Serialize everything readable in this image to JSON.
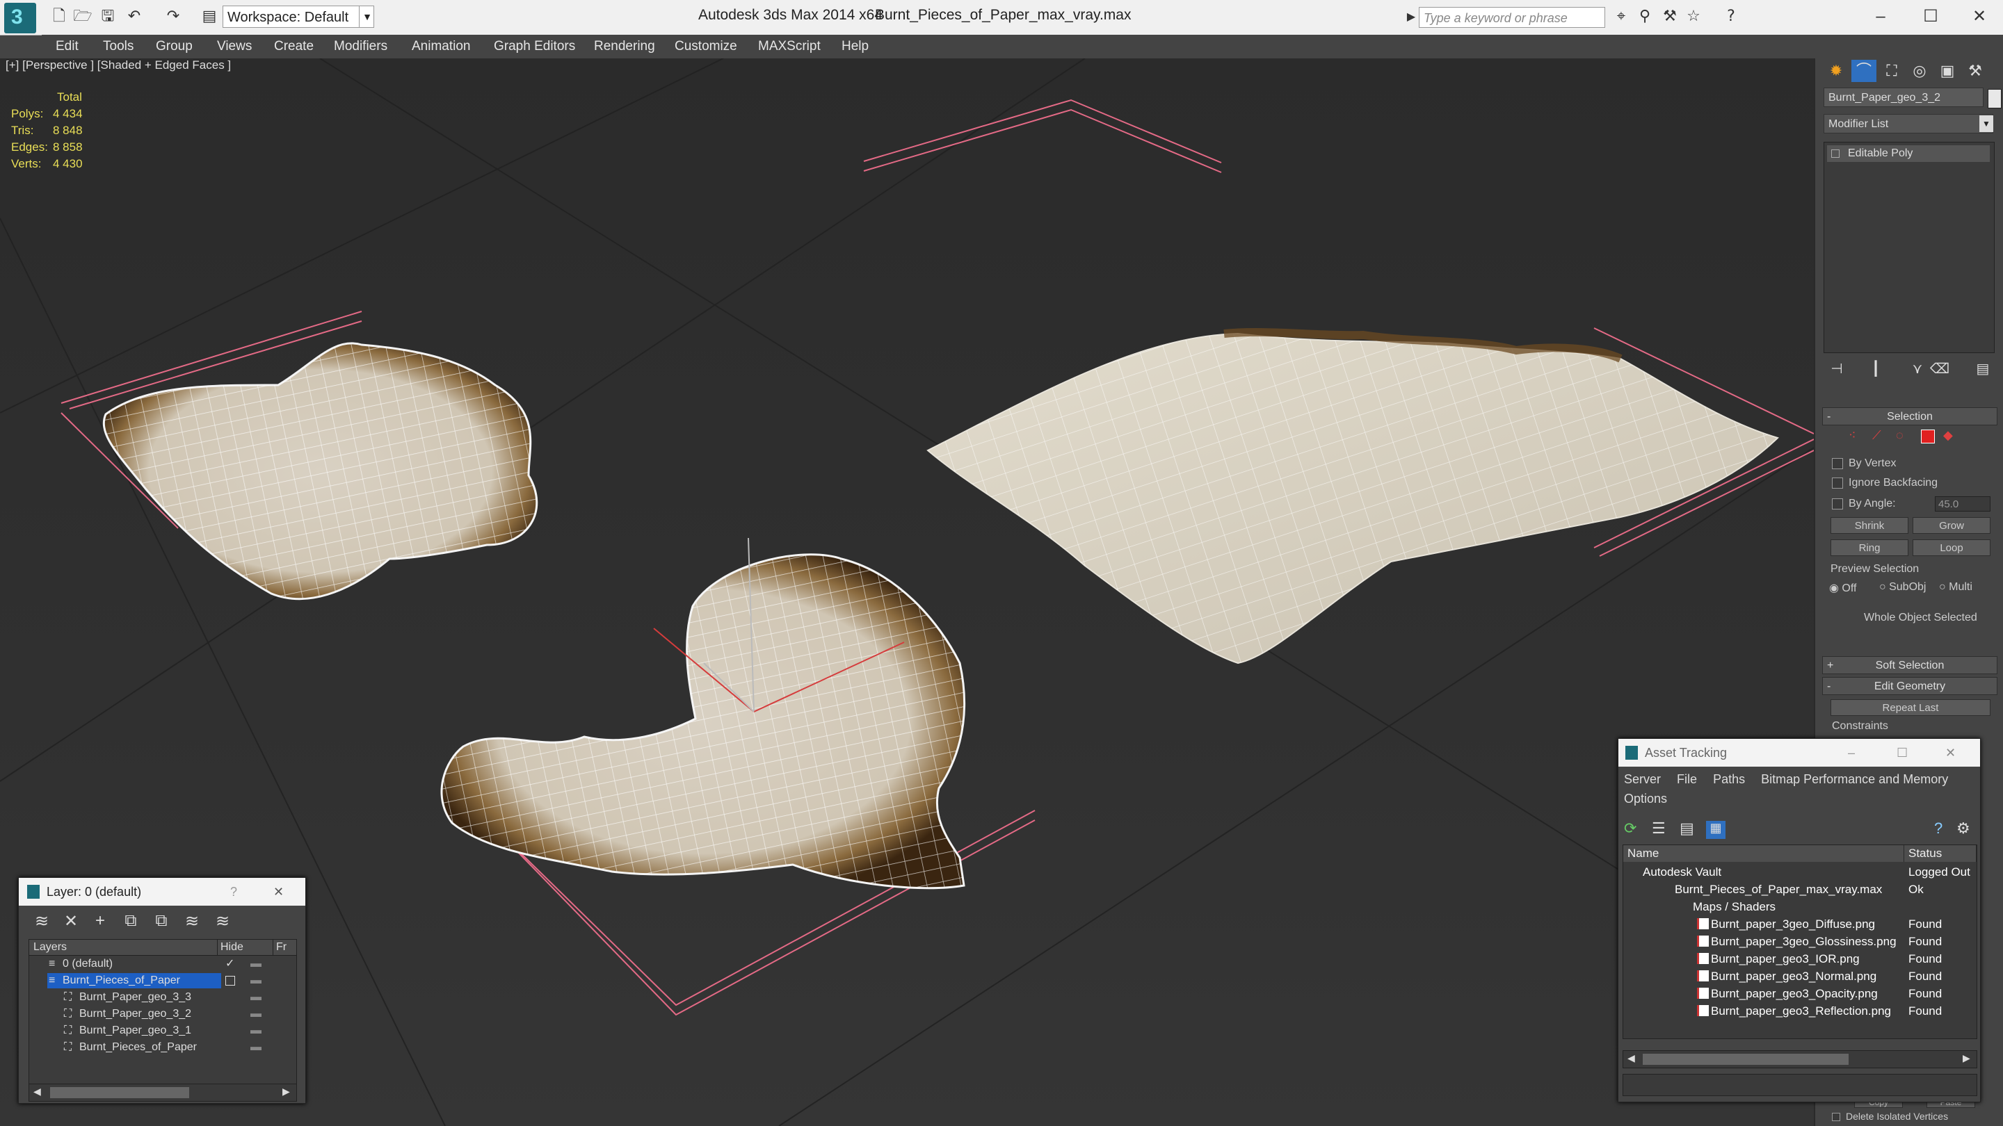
{
  "app": {
    "title": "Autodesk 3ds Max  2014 x64",
    "file": "Burnt_Pieces_of_Paper_max_vray.max",
    "workspace": "Workspace: Default",
    "search_placeholder": "Type a keyword or phrase"
  },
  "menu": [
    "Edit",
    "Tools",
    "Group",
    "Views",
    "Create",
    "Modifiers",
    "Animation",
    "Graph Editors",
    "Rendering",
    "Customize",
    "MAXScript",
    "Help"
  ],
  "viewport": {
    "label": "[+] [Perspective ] [Shaded + Edged Faces ]",
    "stats": {
      "total": "Total",
      "polys_label": "Polys:",
      "polys": "4 434",
      "tris_label": "Tris:",
      "tris": "8 848",
      "edges_label": "Edges:",
      "edges": "8 858",
      "verts_label": "Verts:",
      "verts": "4 430"
    }
  },
  "command_panel": {
    "object_name": "Burnt_Paper_geo_3_2",
    "modifier_list": "Modifier List",
    "stack_item": "Editable Poly",
    "selection_header": "Selection",
    "by_vertex": "By Vertex",
    "ignore_backfacing": "Ignore Backfacing",
    "by_angle": "By Angle:",
    "angle_value": "45.0",
    "shrink": "Shrink",
    "grow": "Grow",
    "ring": "Ring",
    "loop": "Loop",
    "preview_selection": "Preview Selection",
    "off": "Off",
    "subobj": "SubObj",
    "multi": "Multi",
    "whole_object": "Whole Object Selected",
    "soft_selection": "Soft Selection",
    "edit_geometry": "Edit Geometry",
    "repeat_last": "Repeat Last",
    "constraints": "Constraints",
    "copy": "Copy",
    "paste": "Paste",
    "delete_isolated": "Delete Isolated Vertices",
    "plus": "+",
    "minus": "-",
    "accent": "#e02020"
  },
  "layer_window": {
    "title": "Layer: 0 (default)",
    "help": "?",
    "col_layers": "Layers",
    "col_hide": "Hide",
    "col_fr": "Fr",
    "rows": [
      {
        "name": "0 (default)",
        "indent": 0
      },
      {
        "name": "Burnt_Pieces_of_Paper",
        "indent": 0
      },
      {
        "name": "Burnt_Paper_geo_3_3",
        "indent": 1
      },
      {
        "name": "Burnt_Paper_geo_3_2",
        "indent": 1
      },
      {
        "name": "Burnt_Paper_geo_3_1",
        "indent": 1
      },
      {
        "name": "Burnt_Pieces_of_Paper",
        "indent": 1
      }
    ],
    "selected_color": "#1d5fc4"
  },
  "asset_window": {
    "title": "Asset Tracking",
    "menu": [
      "Server",
      "File",
      "Paths",
      "Bitmap Performance and Memory"
    ],
    "menu2": "Options",
    "col_name": "Name",
    "col_status": "Status",
    "rows": [
      {
        "name": "Autodesk Vault",
        "status": "Logged Out",
        "indent": 0
      },
      {
        "name": "Burnt_Pieces_of_Paper_max_vray.max",
        "status": "Ok",
        "indent": 1
      },
      {
        "name": "Maps / Shaders",
        "status": "",
        "indent": 2
      },
      {
        "name": "Burnt_paper_3geo_Diffuse.png",
        "status": "Found",
        "indent": 3
      },
      {
        "name": "Burnt_paper_3geo_Glossiness.png",
        "status": "Found",
        "indent": 3
      },
      {
        "name": "Burnt_paper_geo3_IOR.png",
        "status": "Found",
        "indent": 3
      },
      {
        "name": "Burnt_paper_geo3_Normal.png",
        "status": "Found",
        "indent": 3
      },
      {
        "name": "Burnt_paper_geo3_Opacity.png",
        "status": "Found",
        "indent": 3
      },
      {
        "name": "Burnt_paper_geo3_Reflection.png",
        "status": "Found",
        "indent": 3
      }
    ]
  }
}
